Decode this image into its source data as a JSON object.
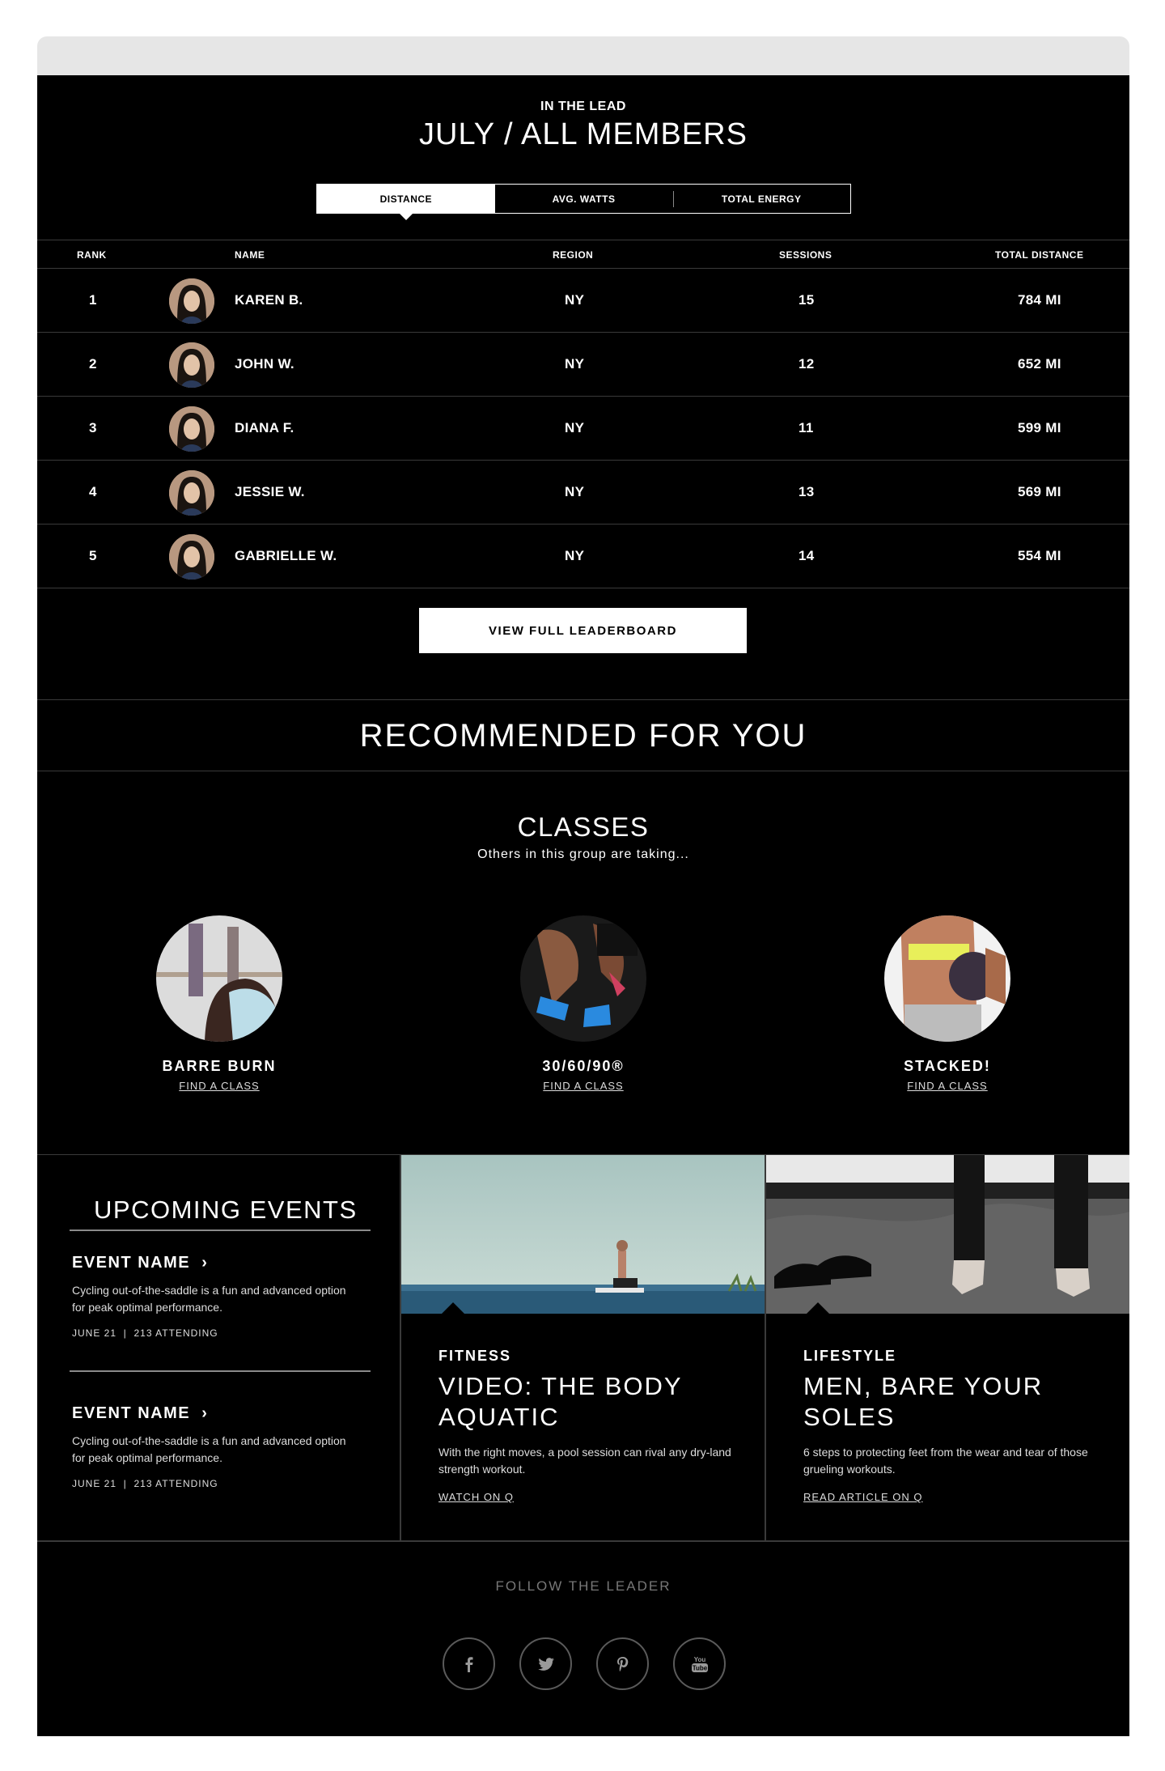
{
  "leaderboard": {
    "eyebrow": "IN THE LEAD",
    "title": "JULY / ALL MEMBERS",
    "tabs": [
      {
        "label": "DISTANCE",
        "active": true
      },
      {
        "label": "AVG. WATTS",
        "active": false
      },
      {
        "label": "TOTAL ENERGY",
        "active": false
      }
    ],
    "columns": {
      "rank": "RANK",
      "name": "NAME",
      "region": "REGION",
      "sessions": "SESSIONS",
      "total": "TOTAL DISTANCE"
    },
    "rows": [
      {
        "rank": "1",
        "name": "KAREN B.",
        "region": "NY",
        "sessions": "15",
        "total": "784 MI"
      },
      {
        "rank": "2",
        "name": "JOHN W.",
        "region": "NY",
        "sessions": "12",
        "total": "652 MI"
      },
      {
        "rank": "3",
        "name": "DIANA F.",
        "region": "NY",
        "sessions": "11",
        "total": "599 MI"
      },
      {
        "rank": "4",
        "name": "JESSIE W.",
        "region": "NY",
        "sessions": "13",
        "total": "569 MI"
      },
      {
        "rank": "5",
        "name": "GABRIELLE W.",
        "region": "NY",
        "sessions": "14",
        "total": "554 MI"
      }
    ],
    "button": "VIEW FULL LEADERBOARD"
  },
  "recommended": {
    "title": "RECOMMENDED FOR YOU",
    "classes_title": "CLASSES",
    "classes_subtitle": "Others in this group are taking...",
    "classes": [
      {
        "name": "BARRE BURN",
        "link": "FIND A CLASS"
      },
      {
        "name": "30/60/90®",
        "link": "FIND A CLASS"
      },
      {
        "name": "STACKED!",
        "link": "FIND A CLASS"
      }
    ]
  },
  "events": {
    "title": "UPCOMING EVENTS",
    "items": [
      {
        "name": "EVENT NAME",
        "chevron": "›",
        "desc": "Cycling out-of-the-saddle is a fun and advanced option for peak optimal performance.",
        "meta": "JUNE 21  |  213 ATTENDING"
      },
      {
        "name": "EVENT NAME",
        "chevron": "›",
        "desc": "Cycling out-of-the-saddle is a fun and advanced option for peak optimal performance.",
        "meta": "JUNE 21  |  213 ATTENDING"
      }
    ]
  },
  "articles": [
    {
      "category": "FITNESS",
      "title": "VIDEO: THE BODY AQUATIC",
      "desc": "With the right moves, a pool session can rival any dry-land strength workout.",
      "link": "WATCH ON Q"
    },
    {
      "category": "LIFESTYLE",
      "title": "MEN, BARE YOUR SOLES",
      "desc": "6 steps to protecting feet from the wear and tear of those grueling workouts.",
      "link": "READ ARTICLE ON Q"
    }
  ],
  "footer": {
    "follow": "FOLLOW THE LEADER",
    "socials": [
      "facebook-icon",
      "twitter-icon",
      "pinterest-icon",
      "youtube-icon"
    ],
    "youtube_label": "You Tube"
  }
}
